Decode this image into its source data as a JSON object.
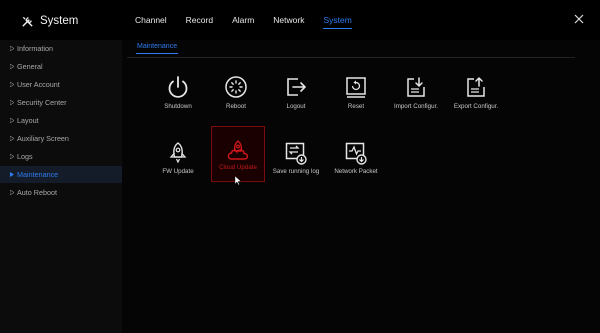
{
  "app": {
    "title": "System",
    "icon": "tools-icon"
  },
  "tabs": [
    {
      "label": "Channel",
      "active": false
    },
    {
      "label": "Record",
      "active": false
    },
    {
      "label": "Alarm",
      "active": false
    },
    {
      "label": "Network",
      "active": false
    },
    {
      "label": "System",
      "active": true
    }
  ],
  "sidebar": {
    "items": [
      {
        "label": "Information",
        "active": false
      },
      {
        "label": "General",
        "active": false
      },
      {
        "label": "User Account",
        "active": false
      },
      {
        "label": "Security Center",
        "active": false
      },
      {
        "label": "Layout",
        "active": false
      },
      {
        "label": "Auxiliary Screen",
        "active": false
      },
      {
        "label": "Logs",
        "active": false
      },
      {
        "label": "Maintenance",
        "active": true
      },
      {
        "label": "Auto Reboot",
        "active": false
      }
    ]
  },
  "main": {
    "subtab": "Maintenance",
    "tiles": [
      {
        "label": "Shutdown",
        "icon": "power-icon"
      },
      {
        "label": "Reboot",
        "icon": "reboot-icon"
      },
      {
        "label": "Logout",
        "icon": "logout-icon"
      },
      {
        "label": "Reset",
        "icon": "reset-icon"
      },
      {
        "label": "Import Configur.",
        "icon": "import-config-icon"
      },
      {
        "label": "Export Configur.",
        "icon": "export-config-icon"
      },
      {
        "label": "FW Update",
        "icon": "rocket-icon"
      },
      {
        "label": "Cloud Update",
        "icon": "cloud-rocket-icon",
        "selected": true
      },
      {
        "label": "Save running log",
        "icon": "save-log-icon"
      },
      {
        "label": "Network Packet",
        "icon": "network-packet-icon"
      }
    ]
  },
  "colors": {
    "accent": "#2f7cf0",
    "selected": "#c01a1a",
    "background": "#000000",
    "sidebar": "#0c0c0c"
  }
}
